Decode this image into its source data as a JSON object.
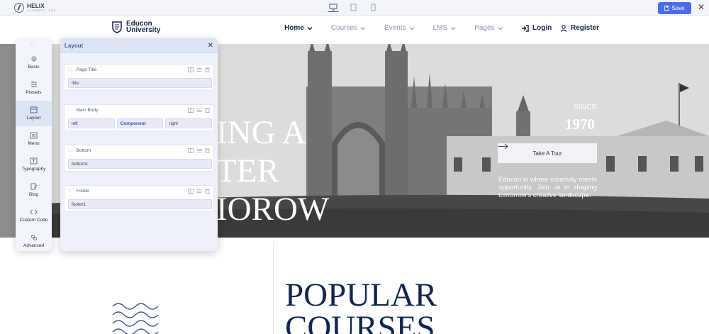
{
  "editor": {
    "app_name": "HELIX",
    "app_sub": "ULTIMATE",
    "version": "2.1.1",
    "save_label": "Save",
    "devices": [
      "desktop-icon",
      "tablet-icon",
      "mobile-icon"
    ],
    "accent_color": "#4b6bea"
  },
  "site": {
    "brand_line1": "Educon",
    "brand_line2": "University",
    "nav": [
      "Home",
      "Courses",
      "Events",
      "LMS",
      "Pages"
    ],
    "login_label": "Login",
    "register_label": "Register"
  },
  "hero": {
    "headline_l1": "ING A",
    "headline_l2": "TER",
    "headline_l3": "IOROW",
    "since_label": "SINCE",
    "year": "1970",
    "tour_label": "Take A Tour",
    "description": "Educon is where creativity meets opportunity. Join us in shaping tomorrow's creative landscape."
  },
  "section": {
    "popular_l1": "POPULAR",
    "popular_l2": "COURSES"
  },
  "toolbar": {
    "handle": ":::",
    "items": [
      "Basic",
      "Presets",
      "Layout",
      "Menu",
      "Typography",
      "Blog",
      "Custom Code",
      "Advanced"
    ]
  },
  "panel": {
    "title": "Layout",
    "handle": ":::",
    "sections": [
      {
        "name": "Page Title",
        "cols": [
          "title"
        ]
      },
      {
        "name": "Main Body",
        "cols": [
          "left",
          "Component",
          "right"
        ]
      },
      {
        "name": "Bottom",
        "cols": [
          "bottom1"
        ]
      },
      {
        "name": "Footer",
        "cols": [
          "footer1"
        ]
      }
    ]
  }
}
